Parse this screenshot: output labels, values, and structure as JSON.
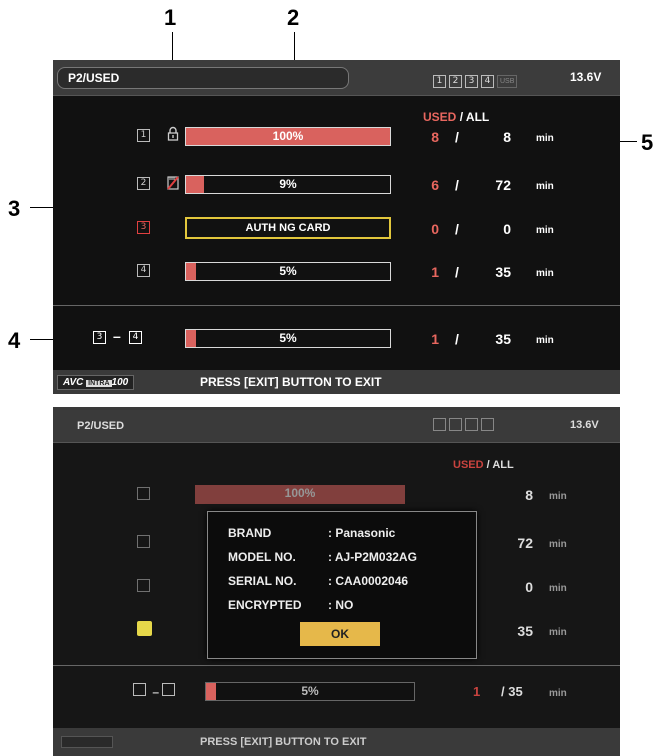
{
  "callouts": [
    "1",
    "2",
    "3",
    "4",
    "5"
  ],
  "screen1": {
    "title": "P2/USED",
    "slots": [
      "1",
      "2",
      "3",
      "4"
    ],
    "usb_label": "USB",
    "voltage": "13.6V",
    "header_used": "USED",
    "header_sep": "/",
    "header_all": "ALL",
    "rows": [
      {
        "slot": "1",
        "percent": 1.0,
        "label": "100%",
        "used": "8",
        "all": "8",
        "unit": "min"
      },
      {
        "slot": "2",
        "percent": 0.09,
        "label": "9%",
        "used": "6",
        "all": "72",
        "unit": "min"
      },
      {
        "slot": "3",
        "auth": "AUTH NG CARD",
        "used": "0",
        "all": "0",
        "unit": "min"
      },
      {
        "slot": "4",
        "percent": 0.05,
        "label": "5%",
        "used": "1",
        "all": "35",
        "unit": "min"
      }
    ],
    "range": {
      "from": "3",
      "dash": "–",
      "to": "4",
      "percent": 0.05,
      "label": "5%",
      "used": "1",
      "all": "35",
      "unit": "min"
    },
    "slash": "/",
    "logo": {
      "avc": "AVC",
      "intra": "INTRA",
      "num": "100"
    },
    "footer": "PRESS [EXIT] BUTTON TO EXIT",
    "colors": {
      "used": "#e8675f",
      "bar_fill": "#d9625e",
      "auth_border": "#e2c73c"
    }
  },
  "screen2": {
    "title": "P2/USED",
    "voltage": "13.6V",
    "header_used": "USED",
    "header_all": "/ ALL",
    "rows": [
      {
        "label": "100%",
        "all": "8",
        "unit": "min"
      },
      {
        "all": "72",
        "unit": "min"
      },
      {
        "all": "0",
        "unit": "min"
      },
      {
        "all": "35",
        "unit": "min"
      }
    ],
    "range": {
      "label": "5%",
      "used": "1",
      "all": "/ 35",
      "unit": "min"
    },
    "dialog": {
      "brand_key": "BRAND",
      "brand_val": ": Panasonic",
      "model_key": "MODEL NO.",
      "model_val": ": AJ-P2M032AG",
      "serial_key": "SERIAL NO.",
      "serial_val": ": CAA0002046",
      "enc_key": "ENCRYPTED",
      "enc_val": ": NO",
      "ok": "OK"
    },
    "footer": "PRESS [EXIT] BUTTON TO EXIT"
  }
}
